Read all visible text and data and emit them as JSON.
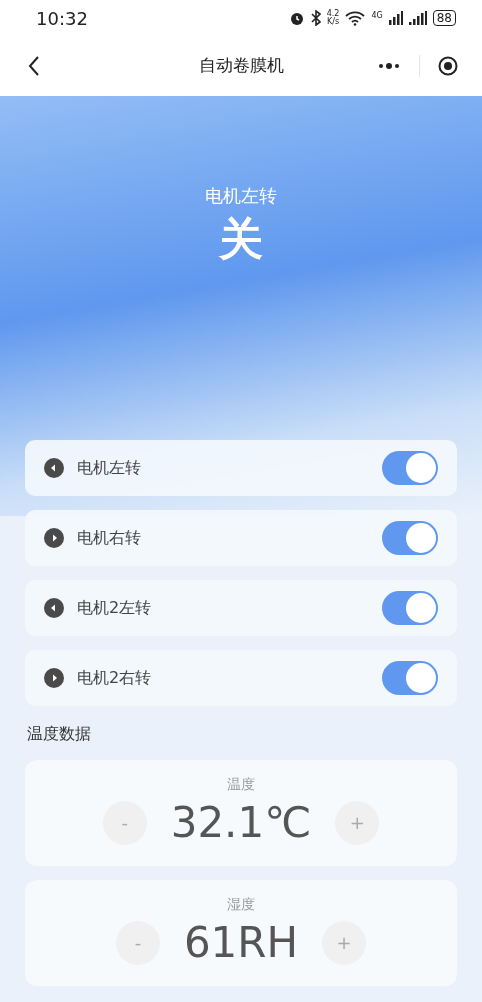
{
  "status_bar": {
    "time": "10:32",
    "speed_value": "4.2",
    "speed_unit": "K/s",
    "network": "4G",
    "battery": "88"
  },
  "nav": {
    "title": "自动卷膜机"
  },
  "hero": {
    "label": "电机左转",
    "state": "关"
  },
  "switches": [
    {
      "label": "电机左转",
      "kind": "left",
      "on": true
    },
    {
      "label": "电机右转",
      "kind": "right",
      "on": true
    },
    {
      "label": "电机2左转",
      "kind": "left",
      "on": true
    },
    {
      "label": "电机2右转",
      "kind": "right",
      "on": true
    }
  ],
  "section_title": "温度数据",
  "readings": [
    {
      "label": "温度",
      "value": "32.1℃",
      "minus": "-",
      "plus": "+"
    },
    {
      "label": "湿度",
      "value": "61RH",
      "minus": "-",
      "plus": "+"
    }
  ]
}
